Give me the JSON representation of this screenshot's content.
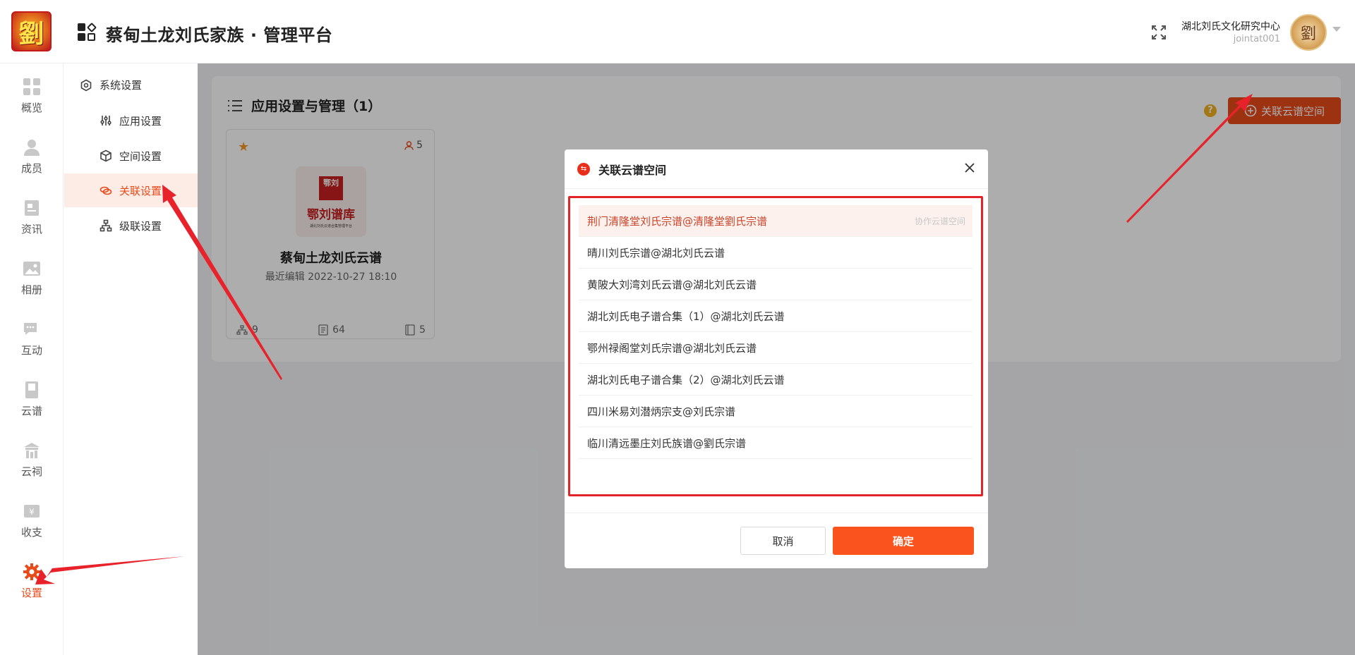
{
  "header": {
    "logo_char": "劉",
    "title": "蔡甸土龙刘氏家族 · 管理平台",
    "org_name": "湖北刘氏文化研究中心",
    "user_id": "jointat001",
    "avatar_char": "劉"
  },
  "rail": {
    "items": [
      {
        "label": "概览",
        "icon": "dashboard-icon"
      },
      {
        "label": "成员",
        "icon": "user-icon"
      },
      {
        "label": "资讯",
        "icon": "news-icon"
      },
      {
        "label": "相册",
        "icon": "image-icon"
      },
      {
        "label": "互动",
        "icon": "chat-icon"
      },
      {
        "label": "云谱",
        "icon": "book-icon"
      },
      {
        "label": "云祠",
        "icon": "temple-icon"
      },
      {
        "label": "收支",
        "icon": "money-icon"
      },
      {
        "label": "设置",
        "icon": "gear-icon"
      }
    ],
    "active_color": "#e84b1a"
  },
  "subnav": {
    "group_label": "系统设置",
    "items": [
      {
        "label": "应用设置",
        "icon": "sliders-icon"
      },
      {
        "label": "空间设置",
        "icon": "cube-icon"
      },
      {
        "label": "关联设置",
        "icon": "link-icon"
      },
      {
        "label": "级联设置",
        "icon": "hierarchy-icon"
      }
    ]
  },
  "panel": {
    "title": "应用设置与管理（1）",
    "primary_button": "关联云谱空间"
  },
  "card": {
    "member_count": "5",
    "cover_seal": "鄂刘",
    "cover_title": "鄂刘谱库",
    "cover_subtitle": "湖北刘氏云谱合集管理平台",
    "title": "蔡甸土龙刘氏云谱",
    "last_edit": "最近编辑 2022-10-27 18:10",
    "stats": {
      "branches": "9",
      "pages": "64",
      "volumes": "5"
    }
  },
  "modal": {
    "title": "关联云谱空间",
    "items": [
      {
        "label": "荆门清隆堂刘氏宗谱@清隆堂劉氏宗谱",
        "tag": "协作云谱空间",
        "selected": true
      },
      {
        "label": "晴川刘氏宗谱@湖北刘氏云谱",
        "tag": "",
        "selected": false
      },
      {
        "label": "黄陂大刘湾刘氏云谱@湖北刘氏云谱",
        "tag": "",
        "selected": false
      },
      {
        "label": "湖北刘氏电子谱合集（1）@湖北刘氏云谱",
        "tag": "",
        "selected": false
      },
      {
        "label": "鄂州禄阁堂刘氏宗谱@湖北刘氏云谱",
        "tag": "",
        "selected": false
      },
      {
        "label": "湖北刘氏电子谱合集（2）@湖北刘氏云谱",
        "tag": "",
        "selected": false
      },
      {
        "label": "四川米易刘潜炳宗支@刘氏宗谱",
        "tag": "",
        "selected": false
      },
      {
        "label": "临川清远墨庄刘氏族谱@劉氏宗谱",
        "tag": "",
        "selected": false
      }
    ],
    "cancel_label": "取消",
    "ok_label": "确定"
  },
  "colors": {
    "accent": "#e84b1a",
    "confirm": "#fb531e",
    "highlight_border": "#e2232a",
    "annotation_arrow": "#e8222a"
  }
}
